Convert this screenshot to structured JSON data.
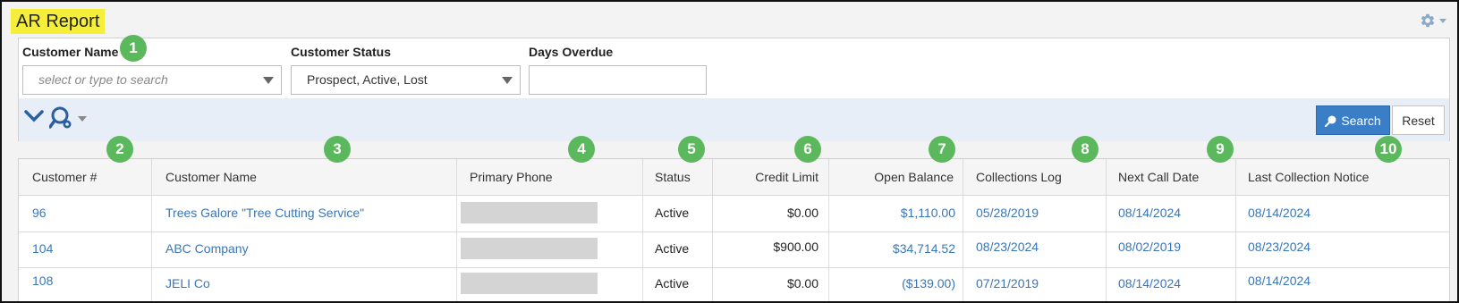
{
  "page": {
    "title": "AR Report"
  },
  "filters": {
    "customer_name": {
      "label": "Customer Name",
      "placeholder": "select or type to search"
    },
    "customer_status": {
      "label": "Customer Status",
      "value": "Prospect, Active, Lost"
    },
    "days_overdue": {
      "label": "Days Overdue",
      "value": ""
    }
  },
  "toolbar": {
    "search_label": "Search",
    "reset_label": "Reset"
  },
  "badges": [
    "1",
    "2",
    "3",
    "4",
    "5",
    "6",
    "7",
    "8",
    "9",
    "10"
  ],
  "table": {
    "columns": [
      "Customer #",
      "Customer Name",
      "Primary Phone",
      "Status",
      "Credit Limit",
      "Open Balance",
      "Collections Log",
      "Next Call Date",
      "Last Collection Notice"
    ],
    "rows": [
      {
        "customer_no": "96",
        "customer_name": "Trees Galore \"Tree Cutting Service\"",
        "status": "Active",
        "credit_limit": "$0.00",
        "open_balance": "$1,110.00",
        "collections_log": "05/28/2019",
        "next_call_date": "08/14/2024",
        "last_notice": "08/14/2024"
      },
      {
        "customer_no": "104",
        "customer_name": "ABC Company",
        "status": "Active",
        "credit_limit": "$900.00",
        "open_balance": "$34,714.52",
        "collections_log": "08/23/2024",
        "next_call_date": "08/02/2019",
        "last_notice": "08/23/2024"
      },
      {
        "customer_no": "108",
        "customer_name": "JELI Co",
        "status": "Active",
        "credit_limit": "$0.00",
        "open_balance": "($139.00)",
        "collections_log": "07/21/2019",
        "next_call_date": "08/14/2024",
        "last_notice": "08/14/2024"
      }
    ]
  },
  "colors": {
    "title_highlight": "#f5ef3c",
    "link": "#3a76b8",
    "primary_button": "#3a7ec8",
    "badge": "#5cb85c"
  },
  "icons": [
    "gear-icon",
    "chevron-down-icon",
    "search-settings-icon",
    "search-icon"
  ]
}
